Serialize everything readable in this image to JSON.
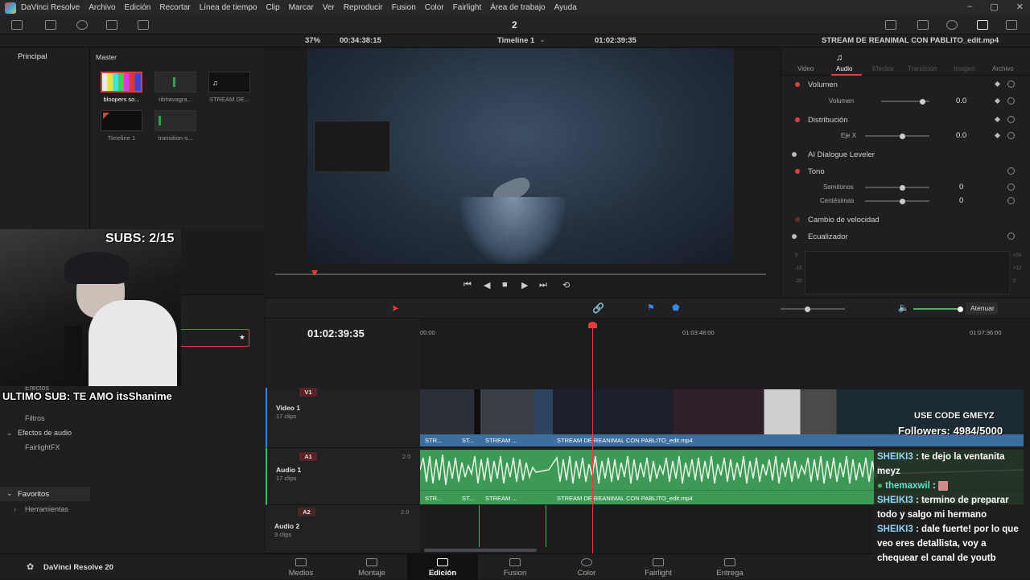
{
  "menubar": {
    "items": [
      "DaVinci Resolve",
      "Archivo",
      "Edición",
      "Recortar",
      "Línea de tiempo",
      "Clip",
      "Marcar",
      "Ver",
      "Reproducir",
      "Fusion",
      "Color",
      "Fairlight",
      "Área de trabajo",
      "Ayuda"
    ],
    "center_number": "2"
  },
  "viewer_header": {
    "zoom": "37%",
    "source_timecode": "00:34:38:15",
    "timeline_name": "Timeline 1",
    "record_timecode": "01:02:39:35"
  },
  "media_pool": {
    "tab_principal": "Principal",
    "tab_master": "Master",
    "clips": [
      {
        "label": "bloopers so..."
      },
      {
        "label": "ribhavagra..."
      },
      {
        "label": "STREAM DE..."
      },
      {
        "label": "Timeline 1"
      },
      {
        "label": "transition-s..."
      }
    ]
  },
  "effects_panel": {
    "items": [
      "Efectos",
      "Filtros",
      "Efectos de audio",
      "FairlightFX"
    ],
    "favoritos": "Favoritos",
    "herramientas": "Herramientas"
  },
  "inspector": {
    "clip_title": "STREAM DE REANIMAL CON PABLITO_edit.mp4",
    "tabs": [
      "Video",
      "Audio",
      "Efectos",
      "Transición",
      "Imagen",
      "Archivo"
    ],
    "active_tab": "Audio",
    "volumen": {
      "title": "Volumen",
      "label": "Volumen",
      "value": "0.0"
    },
    "distribucion": {
      "title": "Distribución",
      "label": "Eje X",
      "value": "0.0"
    },
    "dialogue_leveler": "AI Dialogue Leveler",
    "tono": {
      "title": "Tono",
      "semitonos_label": "Semitonos",
      "semitonos_value": "0",
      "centesimas_label": "Centésimas",
      "centesimas_value": "0"
    },
    "cambio_velocidad": "Cambio de velocidad",
    "ecualizador": "Ecualizador",
    "eq_left_labels": [
      "0",
      "-15",
      "-20"
    ],
    "eq_right_labels": [
      "+24",
      "+12",
      "0"
    ]
  },
  "timeline": {
    "timecode": "01:02:39:35",
    "ruler": [
      "00:00",
      "01:03:48:00",
      "01:07:36:00"
    ],
    "attenuate_label": "Atenuar",
    "tracks": {
      "v1": {
        "tag": "V1",
        "name": "Video 1",
        "clips": "17 clips"
      },
      "a1": {
        "tag": "A1",
        "name": "Audio 1",
        "clips": "17 clips",
        "level": "2.0"
      },
      "a2": {
        "tag": "A2",
        "name": "Audio 2",
        "clips": "3 clips",
        "level": "2.0"
      }
    },
    "clip_labels": {
      "short1": "STR...",
      "short2": "ST...",
      "stream": "STREAM ...",
      "full": "STREAM DE REANIMAL CON PABLITO_edit.mp4"
    }
  },
  "overlay": {
    "subs": "SUBS: 2/15",
    "last_sub": "ULTIMO SUB: TE AMO itsShanime",
    "use_code": "USE CODE GMEYZ",
    "followers": "Followers: 4984/5000",
    "chat": [
      {
        "user": "SHEIKI3",
        "text": " : te dejo la ventanita meyz"
      },
      {
        "user": "themaxwil",
        "text": " :"
      },
      {
        "user": "SHEIKI3",
        "text": " : termino de preparar todo y salgo mi hermano"
      },
      {
        "user": "SHEIKI3",
        "text": " : dale fuerte! por lo que veo eres detallista, voy a chequear el canal de youtb"
      }
    ]
  },
  "bottom": {
    "brand": "DaVinci Resolve 20",
    "pages": [
      "Medios",
      "Montaje",
      "Edición",
      "Fusion",
      "Color",
      "Fairlight",
      "Entrega"
    ],
    "active_page": "Edición"
  },
  "colors": {
    "accent_red": "#e0403c",
    "video_clip": "#3d6f9e",
    "audio_clip": "#3d9a56"
  }
}
